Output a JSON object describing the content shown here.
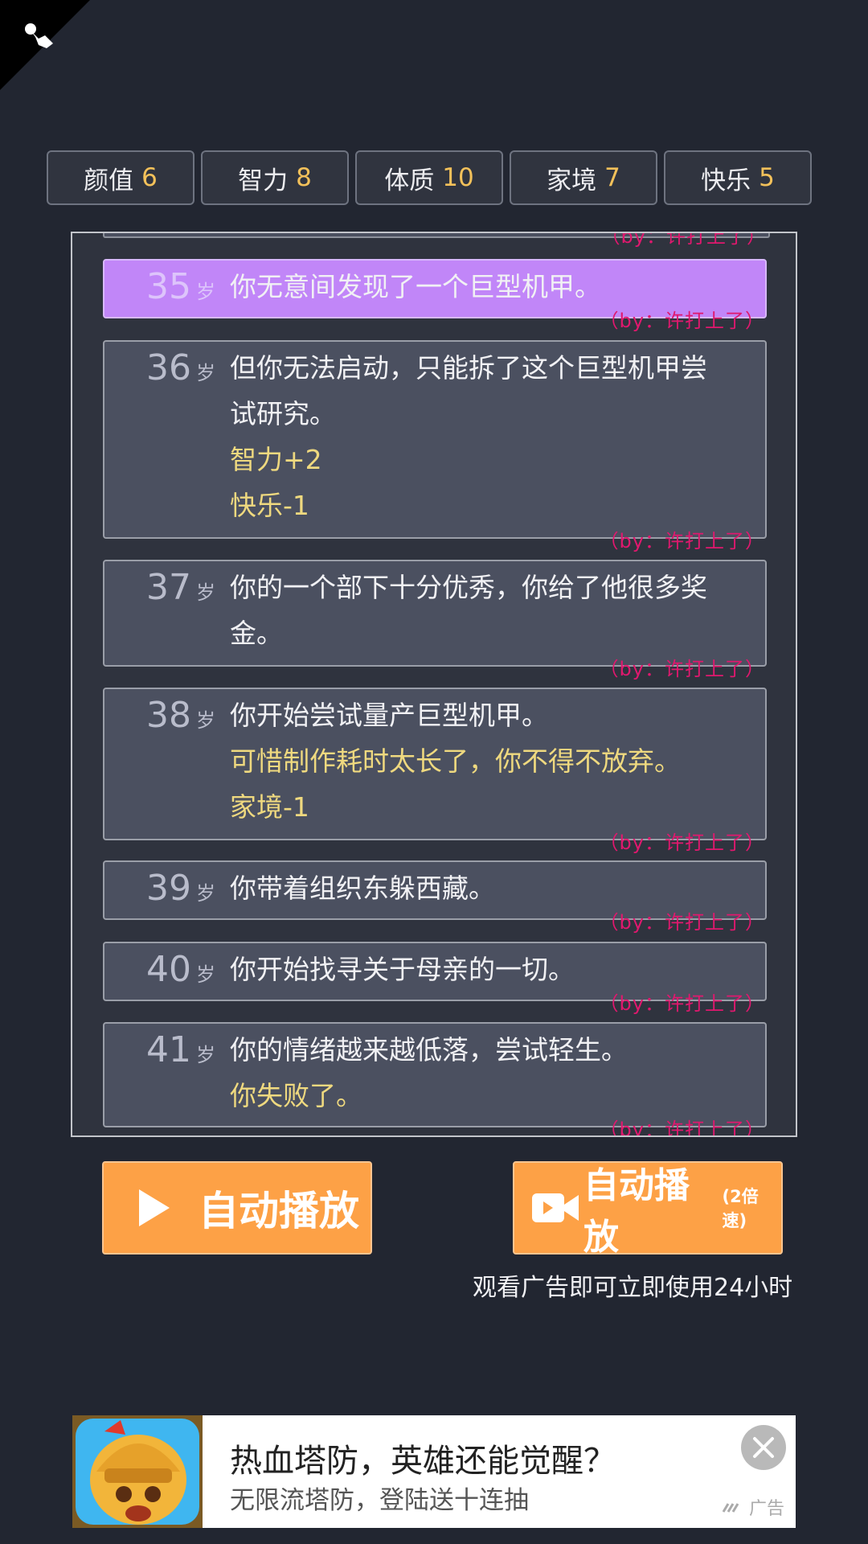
{
  "stats": [
    {
      "label": "颜值",
      "value": "6"
    },
    {
      "label": "智力",
      "value": "8"
    },
    {
      "label": "体质",
      "value": "10"
    },
    {
      "label": "家境",
      "value": "7"
    },
    {
      "label": "快乐",
      "value": "5"
    }
  ],
  "log": {
    "credit": "（by：许打上了）",
    "age_unit": "岁",
    "entries": [
      {
        "age": "35",
        "lines": [
          {
            "text": "你无意间发现了一个巨型机甲。",
            "yellow": false
          }
        ]
      },
      {
        "age": "36",
        "lines": [
          {
            "text": "但你无法启动，只能拆了这个巨型机甲尝",
            "yellow": false
          },
          {
            "text": "试研究。",
            "yellow": false
          },
          {
            "text": "智力+2",
            "yellow": true
          },
          {
            "text": "快乐-1",
            "yellow": true
          }
        ]
      },
      {
        "age": "37",
        "lines": [
          {
            "text": "你的一个部下十分优秀，你给了他很多奖",
            "yellow": false
          },
          {
            "text": "金。",
            "yellow": false
          }
        ]
      },
      {
        "age": "38",
        "lines": [
          {
            "text": "你开始尝试量产巨型机甲。",
            "yellow": false
          },
          {
            "text": "可惜制作耗时太长了，你不得不放弃。",
            "yellow": true
          },
          {
            "text": "家境-1",
            "yellow": true
          }
        ]
      },
      {
        "age": "39",
        "lines": [
          {
            "text": "你带着组织东躲西藏。",
            "yellow": false
          }
        ]
      },
      {
        "age": "40",
        "lines": [
          {
            "text": "你开始找寻关于母亲的一切。",
            "yellow": false
          }
        ]
      },
      {
        "age": "41",
        "lines": [
          {
            "text": "你的情绪越来越低落，尝试轻生。",
            "yellow": false
          },
          {
            "text": "你失败了。",
            "yellow": true
          }
        ]
      }
    ]
  },
  "buttons": {
    "autoplay": "自动播放",
    "autoplay_fast": "自动播放",
    "autoplay_fast_suffix": "(2倍速)",
    "ad_note": "观看广告即可立即使用24小时"
  },
  "ad": {
    "title": "热血塔防，英雄还能觉醒？",
    "subtitle": "无限流塔防，登陆送十连抽",
    "label": "广告"
  },
  "icons": {
    "corner": "pawn-icon",
    "play": "play-icon",
    "video": "video-camera-icon",
    "close": "close-icon"
  },
  "colors": {
    "background": "#222631",
    "accent": "#fda146",
    "highlight": "#c186f8",
    "stat_value": "#f3c15a",
    "effect_text": "#efd97f",
    "credit": "#e0186e"
  }
}
